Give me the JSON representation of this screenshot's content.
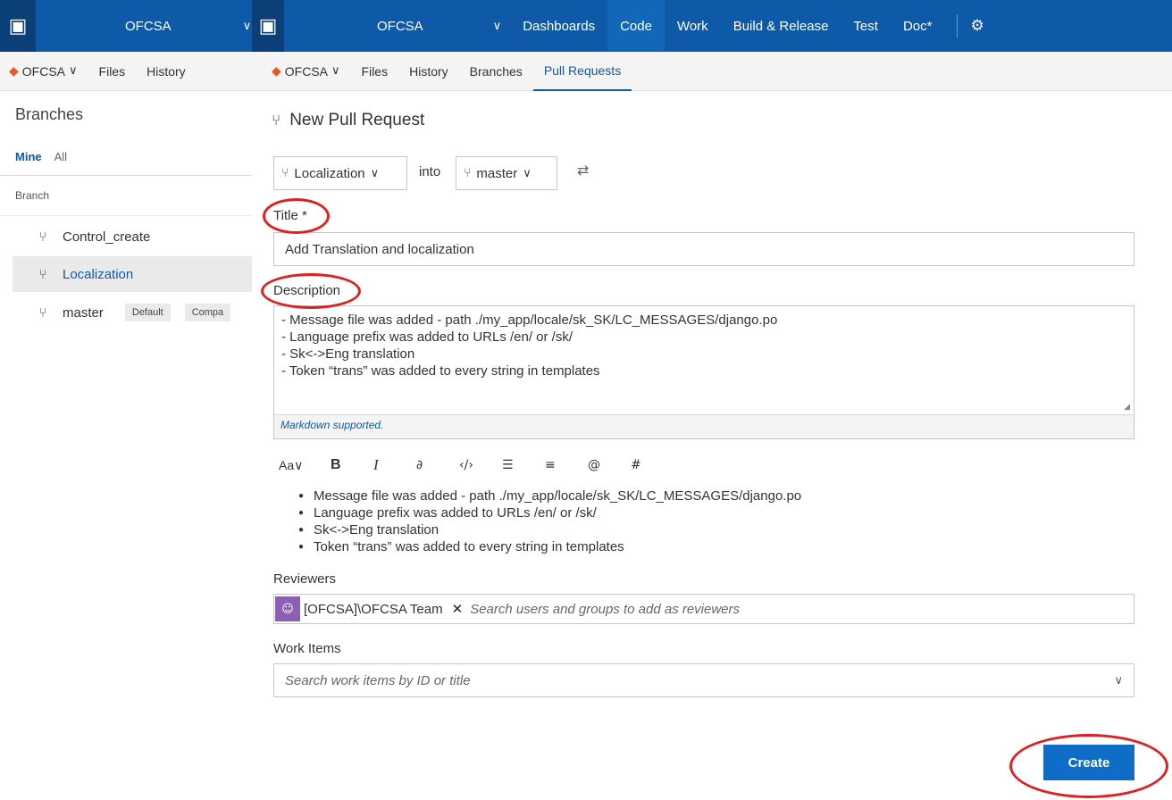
{
  "colors": {
    "brand_blue": "#0f5aa8",
    "active_hub": "#1267b8",
    "create_button": "#0f6cc7",
    "annotation": "#e02020",
    "repo_icon": "#e25b2d"
  },
  "left_window": {
    "project": "OFCSA",
    "repo": "OFCSA",
    "subnav": [
      "Files",
      "History"
    ],
    "branches_title": "Branches",
    "pivot": {
      "mine": "Mine",
      "all": "All"
    },
    "column_header": "Branch",
    "branches": [
      {
        "name": "Control_create"
      },
      {
        "name": "Localization"
      },
      {
        "name": "master",
        "tag": "Default",
        "tag2": "Compa"
      }
    ]
  },
  "main_window": {
    "project": "OFCSA",
    "hubs": [
      "Dashboards",
      "Code",
      "Work",
      "Build & Release",
      "Test",
      "Doc*"
    ],
    "repo": "OFCSA",
    "subnav": [
      "Files",
      "History",
      "Branches",
      "Pull Requests"
    ],
    "page_title": "New Pull Request",
    "source_branch": "Localization",
    "into_label": "into",
    "target_branch": "master",
    "title_label": "Title *",
    "title_value": "Add Translation and localization",
    "description_label": "Description",
    "description_lines": [
      "- Message file was added - path ./my_app/locale/sk_SK/LC_MESSAGES/django.po",
      "- Language prefix was added to URLs /en/ or /sk/",
      "- Sk<->Eng translation",
      "- Token “trans” was added to every string in templates"
    ],
    "markdown_note": "Markdown supported.",
    "toolbar": [
      "Aa∨",
      "B",
      "I",
      "∂",
      "‹/›",
      "☰",
      "≡",
      "@",
      "#"
    ],
    "preview_items": [
      "Message file was added - path ./my_app/locale/sk_SK/LC_MESSAGES/django.po",
      "Language prefix was added to URLs /en/ or /sk/",
      "Sk<->Eng translation",
      "Token “trans” was added to every string in templates"
    ],
    "reviewers_label": "Reviewers",
    "reviewer": "[OFCSA]\\OFCSA Team",
    "reviewers_placeholder": "Search users and groups to add as reviewers",
    "work_items_label": "Work Items",
    "work_items_placeholder": "Search work items by ID or title",
    "create_label": "Create"
  }
}
